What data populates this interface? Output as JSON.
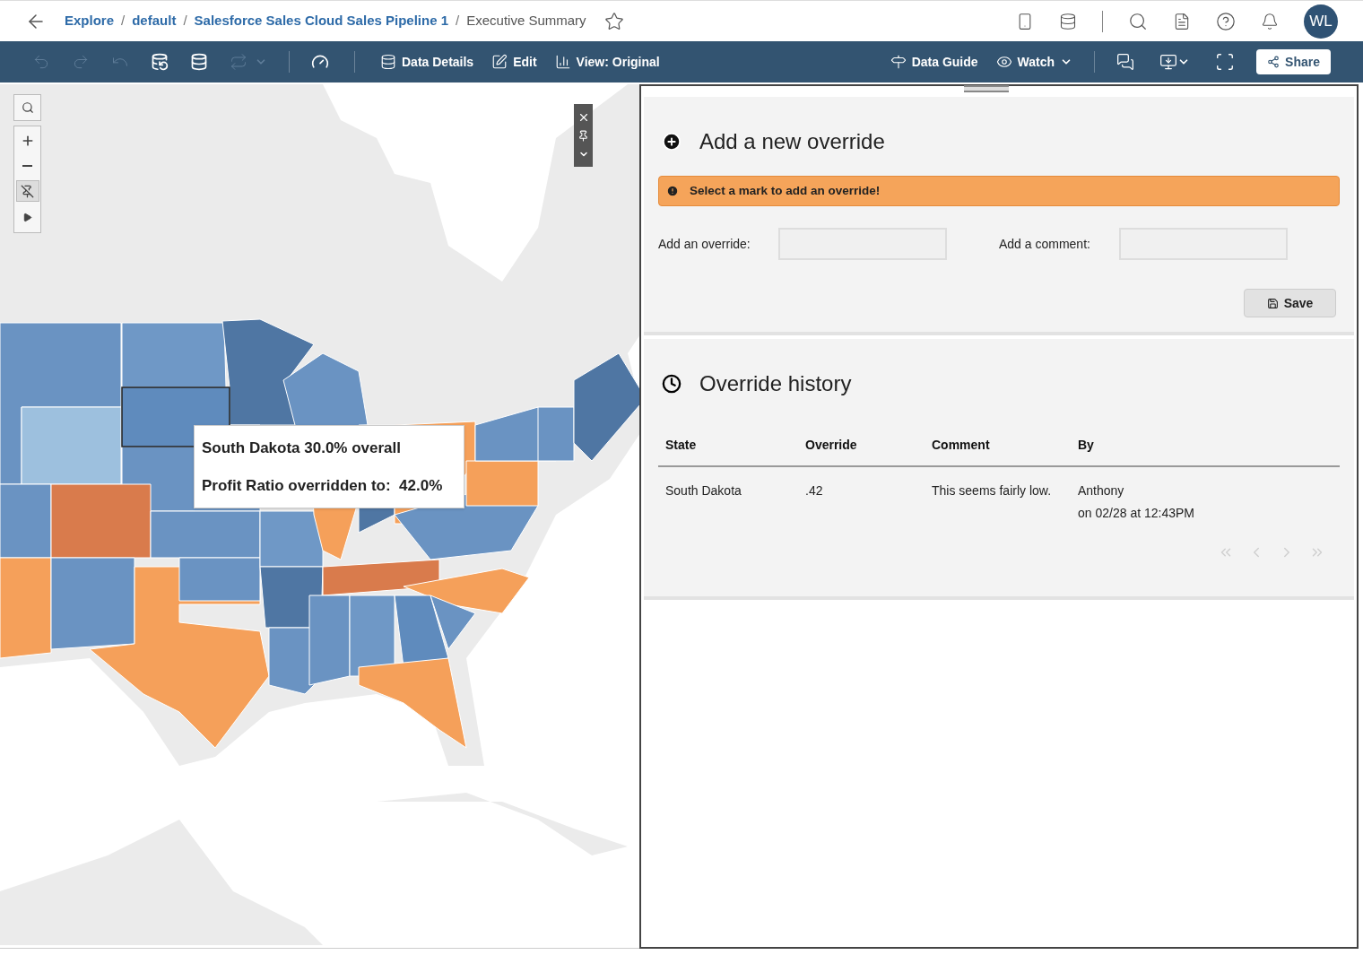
{
  "breadcrumb": [
    {
      "label": "Explore",
      "kind": "link",
      "separator": "/"
    },
    {
      "label": "default",
      "kind": "link",
      "separator": "/"
    },
    {
      "label": "Salesforce Sales Cloud Sales Pipeline 1",
      "kind": "link",
      "separator": "/"
    },
    {
      "label": "Executive Summary",
      "kind": "current"
    }
  ],
  "favorite": {
    "selected": false
  },
  "user": {
    "initials": "WL"
  },
  "toolbar": {
    "left": [
      {
        "kind": "undo",
        "disabled": true
      },
      {
        "kind": "redo",
        "disabled": true
      },
      {
        "kind": "revert",
        "disabled": true
      },
      {
        "kind": "refresh",
        "disabled": false
      },
      {
        "kind": "pause",
        "disabled": false
      },
      {
        "kind": "swap",
        "disabled": true
      },
      {
        "kind": "performance",
        "disabled": false
      }
    ],
    "middle": [
      {
        "kind": "data",
        "label": "Data Details"
      },
      {
        "kind": "edit",
        "label": "Edit"
      },
      {
        "kind": "view",
        "label": "View: Original"
      }
    ],
    "right": [
      {
        "kind": "guide",
        "label": "Data Guide"
      },
      {
        "kind": "watch",
        "label": "Watch"
      }
    ],
    "share": "Share"
  },
  "tooltip": {
    "title": "South Dakota 30.0% overall",
    "line": "Profit Ratio overridden to:  42.0%"
  },
  "override_form": {
    "title": "Add a new override",
    "alert": "Select a mark to add an override!",
    "fields": [
      {
        "label": "Add an override:"
      },
      {
        "label": "Add a comment:"
      }
    ],
    "save": "Save"
  },
  "history": {
    "title": "Override history",
    "columns": [
      "State",
      "Override",
      "Comment",
      "By"
    ],
    "rows": [
      {
        "state": "South Dakota",
        "override": ".42",
        "comment": "This seems fairly low.",
        "by": "Anthony",
        "date": "on 02/28 at 12:43PM"
      }
    ],
    "pager": [
      {
        "kind": "first",
        "disabled": true
      },
      {
        "kind": "prev",
        "disabled": true
      },
      {
        "kind": "next",
        "disabled": true
      },
      {
        "kind": "last",
        "disabled": true
      }
    ]
  }
}
